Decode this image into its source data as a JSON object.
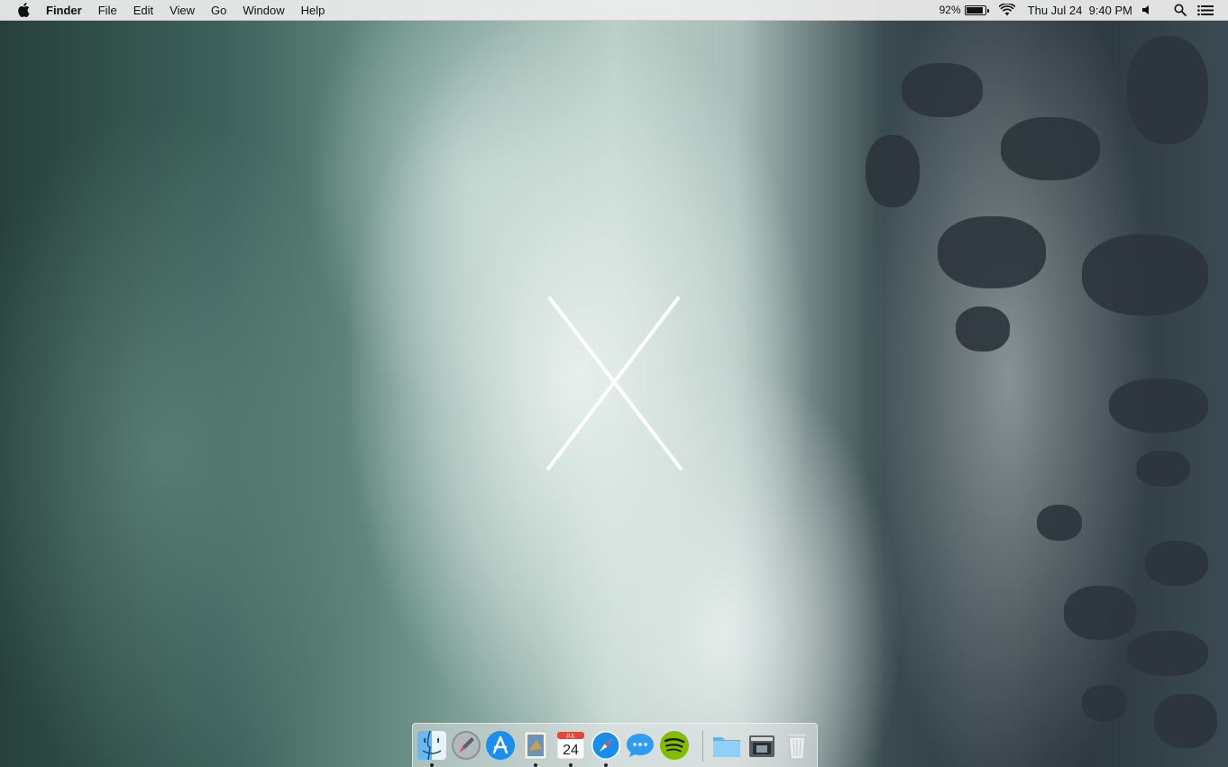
{
  "menubar": {
    "apple_icon": "apple-logo-icon",
    "app_name": "Finder",
    "menus": [
      "File",
      "Edit",
      "View",
      "Go",
      "Window",
      "Help"
    ],
    "status": {
      "battery_percent": "92%",
      "battery_level": 0.92,
      "wifi_icon": "wifi-icon",
      "datetime": "Thu Jul 24  9:40 PM",
      "volume_icon": "speaker-icon",
      "spotlight_icon": "magnifying-glass-icon",
      "notification_icon": "list-icon"
    }
  },
  "desktop": {
    "wallpaper": "ocean-waves-osx-yosemite",
    "accent": "#ffffff"
  },
  "dock": {
    "apps": [
      {
        "icon": "finder-icon",
        "running": true
      },
      {
        "icon": "launchpad-icon",
        "running": false
      },
      {
        "icon": "app-store-icon",
        "running": false
      },
      {
        "icon": "mail-stamp-icon",
        "running": true
      },
      {
        "icon": "calendar-icon",
        "running": true,
        "month": "JUL",
        "day": "24"
      },
      {
        "icon": "safari-icon",
        "running": true
      },
      {
        "icon": "messages-icon",
        "running": false
      },
      {
        "icon": "spotify-icon",
        "running": false
      }
    ],
    "others": [
      {
        "icon": "folder-icon"
      },
      {
        "icon": "image-capture-icon"
      },
      {
        "icon": "trash-icon"
      }
    ]
  }
}
